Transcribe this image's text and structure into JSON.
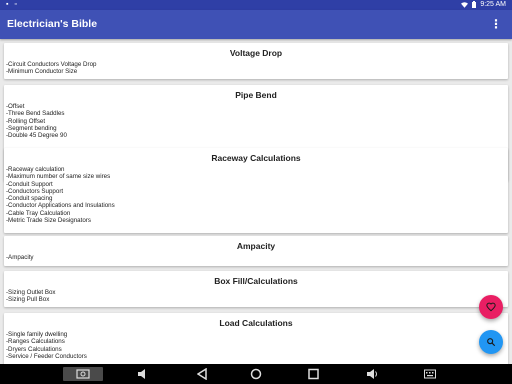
{
  "status_bar": {
    "left_icons": "▪ ▫",
    "time": "9:25 AM"
  },
  "app_bar": {
    "title": "Electrician's Bible",
    "menu_icon": "more-vert-icon",
    "menu_glyph": "⋮"
  },
  "cards": [
    {
      "heading": "Voltage Drop",
      "items": [
        "-Circuit Conductors Voltage Drop",
        "-Minimum Conductor Size"
      ]
    },
    {
      "heading": "Pipe Bend",
      "items": [
        "-Offset",
        "-Three Bend Saddles",
        "-Rolling Offset",
        "-Segment bending",
        "-Double 45 Degree 90"
      ]
    },
    {
      "heading": "Raceway Calculations",
      "items": [
        "-Raceway calculation",
        "-Maximum number of same size wires",
        "-Conduit Support",
        "-Conductors Support",
        "-Conduit spacing",
        "-Conductor Applications and Insulations",
        "-Cable Tray Calculation",
        "-Metric Trade Size Designators"
      ]
    },
    {
      "heading": "Ampacity",
      "items": [
        "-Ampacity"
      ]
    },
    {
      "heading": "Box Fill/Calculations",
      "items": [
        "-Sizing Outlet Box",
        "-Sizing Pull Box"
      ]
    },
    {
      "heading": "Load Calculations",
      "items": [
        "-Single family dwelling",
        "-Ranges Calculations",
        "-Dryers Calculations",
        "-Service / Feeder Conductors"
      ]
    }
  ],
  "fab_favorite": {
    "icon": "heart-icon",
    "color": "#e91e63"
  },
  "fab_search": {
    "icon": "search-icon",
    "color": "#2196f3"
  },
  "nav_bar": {
    "icons": [
      "screenshot-icon",
      "volume-down-icon",
      "back-icon",
      "home-icon",
      "recents-icon",
      "volume-up-icon",
      "keyboard-icon"
    ]
  }
}
